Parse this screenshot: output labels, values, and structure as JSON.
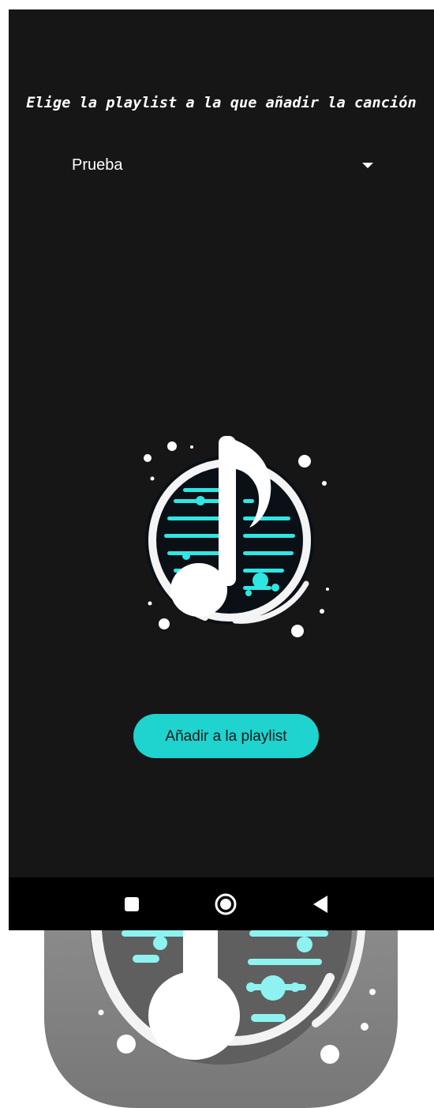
{
  "screen": {
    "prompt_title": "Elige la playlist a la que añadir la canción",
    "playlist_dropdown": {
      "selected": "Prueba"
    },
    "logo_icon": "music-note-logo-icon",
    "add_button_label": "Añadir a la playlist"
  },
  "navigation_bar": {
    "recent_apps_icon": "square-icon",
    "home_icon": "circle-home-icon",
    "back_icon": "triangle-back-icon"
  },
  "colors": {
    "background": "#161616",
    "accent": "#1fd3cf",
    "navigation_bar": "#000000",
    "text": "#ffffff"
  }
}
